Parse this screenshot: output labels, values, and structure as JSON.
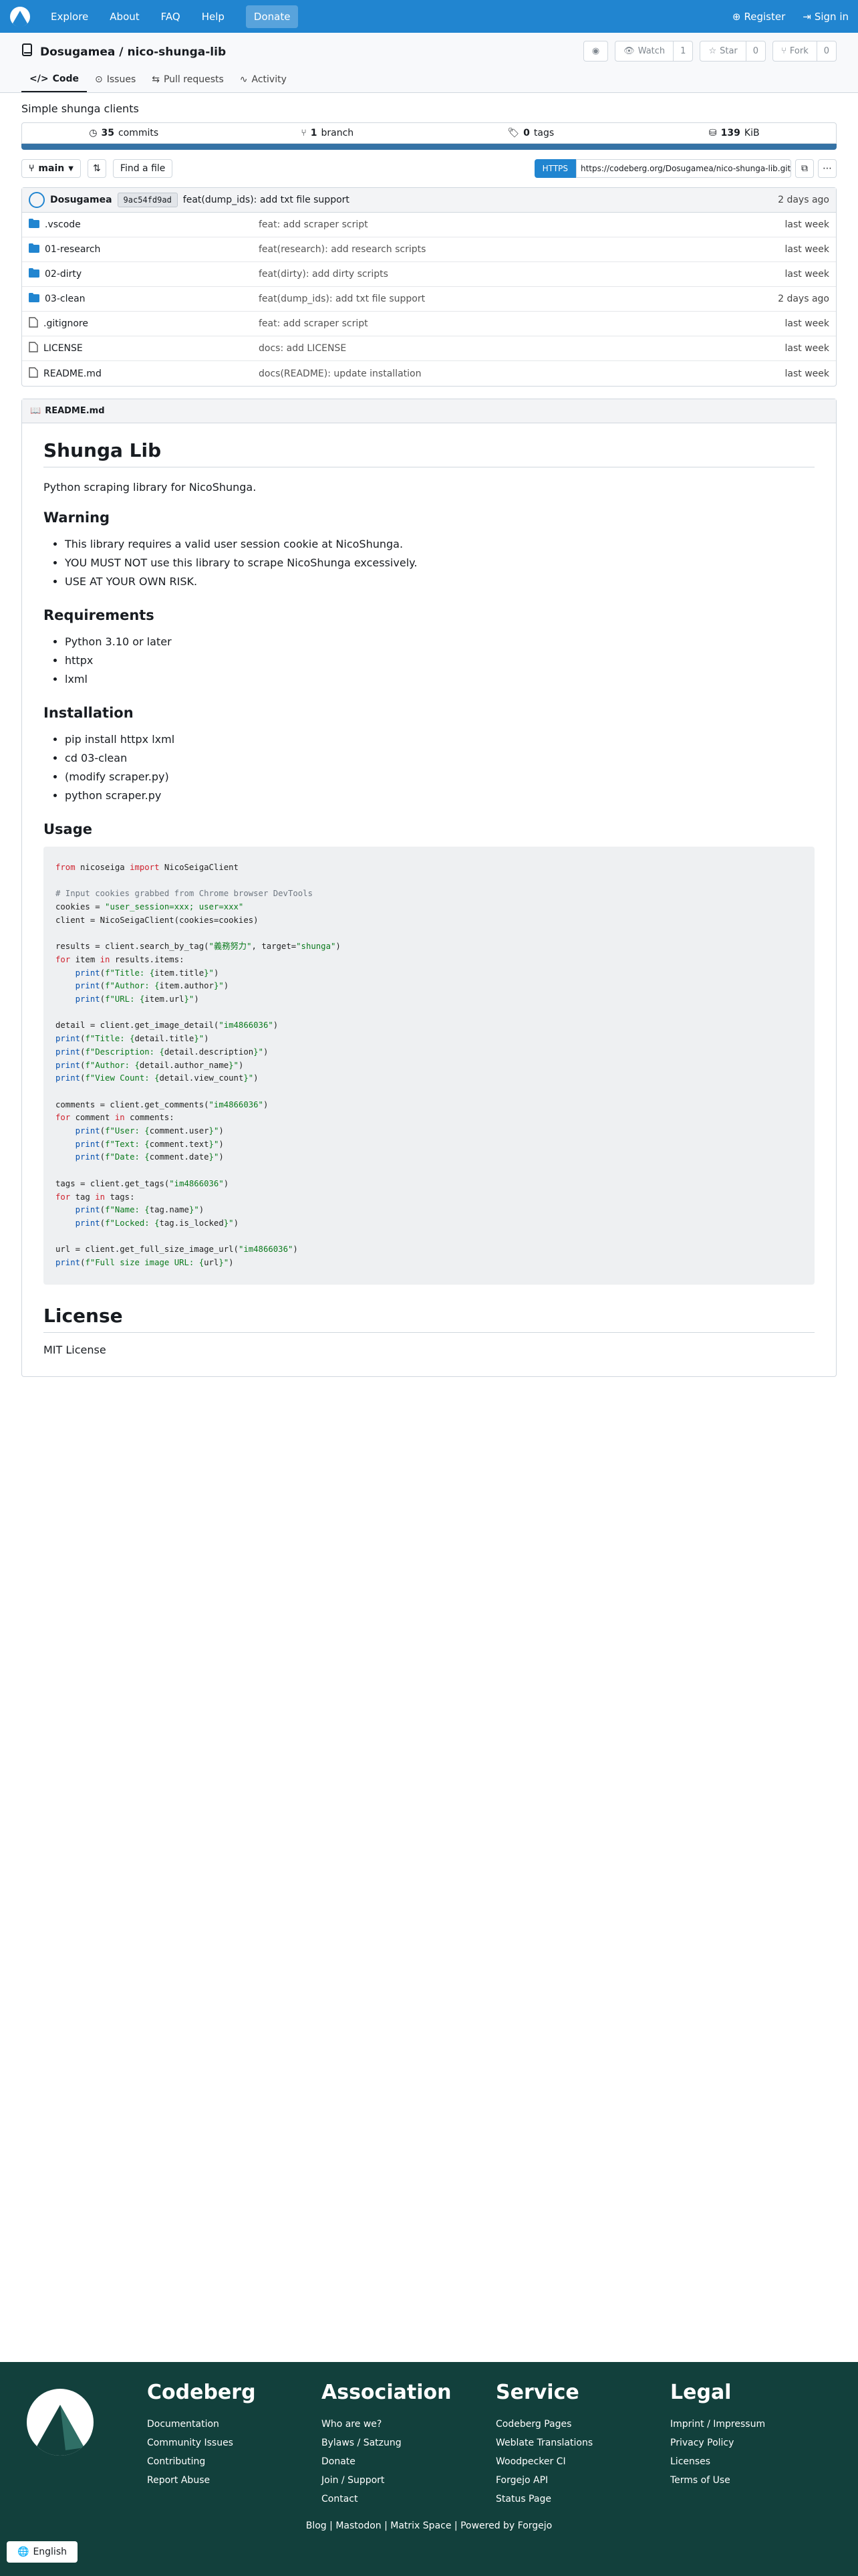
{
  "nav": {
    "items": [
      "Explore",
      "About",
      "FAQ",
      "Help",
      "Donate"
    ],
    "register": "Register",
    "signin": "Sign in"
  },
  "repo": {
    "owner": "Dosugamea",
    "sep": "/",
    "name": "nico-shunga-lib",
    "watch_label": "Watch",
    "watch_count": "1",
    "star_label": "Star",
    "star_count": "0",
    "fork_label": "Fork",
    "fork_count": "0",
    "tabs": [
      "Code",
      "Issues",
      "Pull requests",
      "Activity"
    ],
    "description": "Simple shunga clients"
  },
  "stats": {
    "commits_num": "35",
    "commits_label": "commits",
    "branch_num": "1",
    "branch_label": "branch",
    "tags_num": "0",
    "tags_label": "tags",
    "size_num": "139",
    "size_unit": "KiB"
  },
  "toolbar": {
    "branch": "main",
    "find_file": "Find a file",
    "https": "HTTPS",
    "clone_url": "https://codeberg.org/Dosugamea/nico-shunga-lib.git"
  },
  "last_commit": {
    "author": "Dosugamea",
    "sha": "9ac54fd9ad",
    "message": "feat(dump_ids): add txt file support",
    "date": "2 days ago"
  },
  "files": [
    {
      "name": ".vscode",
      "type": "dir",
      "msg": "feat: add scraper script",
      "date": "last week"
    },
    {
      "name": "01-research",
      "type": "dir",
      "msg": "feat(research): add research scripts",
      "date": "last week"
    },
    {
      "name": "02-dirty",
      "type": "dir",
      "msg": "feat(dirty): add dirty scripts",
      "date": "last week"
    },
    {
      "name": "03-clean",
      "type": "dir",
      "msg": "feat(dump_ids): add txt file support",
      "date": "2 days ago"
    },
    {
      "name": ".gitignore",
      "type": "file",
      "msg": "feat: add scraper script",
      "date": "last week"
    },
    {
      "name": "LICENSE",
      "type": "file",
      "msg": "docs: add LICENSE",
      "date": "last week"
    },
    {
      "name": "README.md",
      "type": "file",
      "msg": "docs(README): update installation",
      "date": "last week"
    }
  ],
  "readme": {
    "filename": "README.md",
    "h1": "Shunga Lib",
    "intro": "Python scraping library for NicoShunga.",
    "warning_h": "Warning",
    "warning": [
      "This library requires a valid user session cookie at NicoShunga.",
      "YOU MUST NOT use this library to scrape NicoShunga excessively.",
      "USE AT YOUR OWN RISK."
    ],
    "req_h": "Requirements",
    "requirements": [
      "Python 3.10 or later",
      "httpx",
      "lxml"
    ],
    "install_h": "Installation",
    "install": [
      "pip install httpx lxml",
      "cd 03-clean",
      "(modify scraper.py)",
      "python scraper.py"
    ],
    "usage_h": "Usage",
    "license_h": "License",
    "license_text": "MIT License"
  },
  "footer": {
    "codeberg_h": "Codeberg",
    "codeberg": [
      "Documentation",
      "Community Issues",
      "Contributing",
      "Report Abuse"
    ],
    "association_h": "Association",
    "association": [
      "Who are we?",
      "Bylaws / Satzung",
      "Donate",
      "Join / Support",
      "Contact"
    ],
    "service_h": "Service",
    "service": [
      "Codeberg Pages",
      "Weblate Translations",
      "Woodpecker CI",
      "Forgejo API",
      "Status Page"
    ],
    "legal_h": "Legal",
    "legal": [
      "Imprint / Impressum",
      "Privacy Policy",
      "Licenses",
      "Terms of Use"
    ],
    "bottom": "Blog | Mastodon | Matrix Space | Powered by Forgejo",
    "language": "English"
  }
}
